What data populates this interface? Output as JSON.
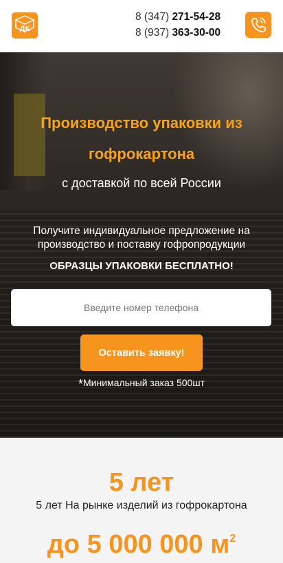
{
  "header": {
    "logo_text": "ДК",
    "phones": [
      {
        "prefix": "8 (347)",
        "number": "271-54-28"
      },
      {
        "prefix": "8 (937)",
        "number": "363-30-00"
      }
    ],
    "call_icon": "phone-icon"
  },
  "hero": {
    "title": "Производство упаковки из гофрокартона",
    "subtitle": "с доставкой по всей России",
    "offer": "Получите индивидуальное предложение на производство и поставку гофропродукции",
    "free_samples": "ОБРАЗЦЫ УПАКОВКИ БЕСПЛАТНО!",
    "phone_placeholder": "Введите номер телефона",
    "submit_label": "Оставить заявку!",
    "min_order_mark": "*",
    "min_order": "Минимальный заказ 500шт"
  },
  "stats": [
    {
      "value": "5 лет",
      "description": "5 лет На рынке изделий из гофрокартона"
    },
    {
      "value": "до 5 000 000 м",
      "unit_sup": "2",
      "description": ""
    }
  ],
  "colors": {
    "accent": "#f7941d",
    "title": "#f7a21b"
  }
}
